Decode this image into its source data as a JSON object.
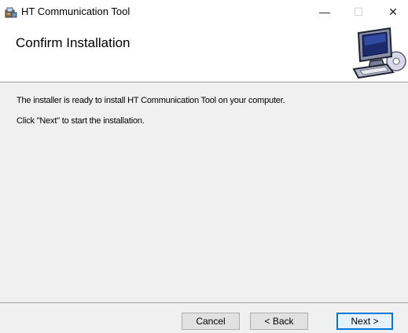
{
  "window": {
    "title": "HT Communication Tool",
    "controls": {
      "minimize": "—",
      "maximize": "☐",
      "close": "✕"
    },
    "icons": {
      "app": "installer-package-icon",
      "header": "computer-install-icon"
    }
  },
  "header": {
    "title": "Confirm Installation"
  },
  "body": {
    "message": "The installer is ready to install HT Communication Tool on your computer.",
    "instruction": "Click \"Next\" to start the installation."
  },
  "buttons": {
    "cancel": "Cancel",
    "back": "< Back",
    "next": "Next >"
  },
  "colors": {
    "accent": "#0078d7",
    "button_face": "#e1e1e1",
    "dialog_bg": "#f0f0f0"
  }
}
